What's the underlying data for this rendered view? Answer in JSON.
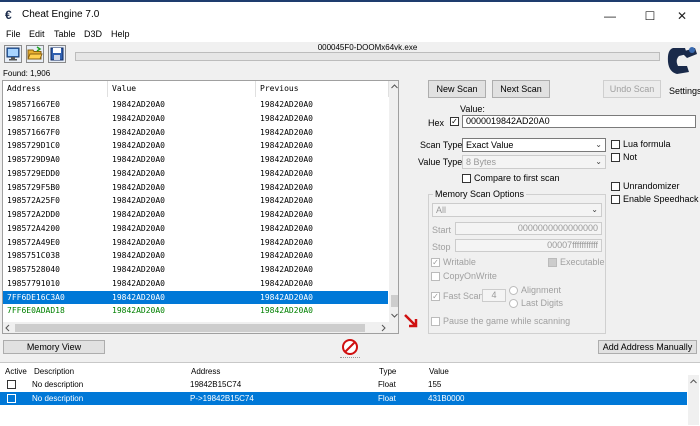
{
  "window": {
    "title": "Cheat Engine 7.0",
    "app_icon_glyph": "€",
    "minimize_glyph": "—",
    "maximize_glyph": "☐",
    "close_glyph": "✕"
  },
  "menu": [
    "File",
    "Edit",
    "Table",
    "D3D",
    "Help"
  ],
  "process_name": "000045F0-DOOMx64vk.exe",
  "found_text": "Found: 1,906",
  "results": {
    "headers": [
      "Address",
      "Value",
      "Previous"
    ],
    "rows": [
      {
        "address": "198571667E0",
        "value": "19842AD20A0",
        "previous": "19842AD20A0"
      },
      {
        "address": "198571667E8",
        "value": "19842AD20A0",
        "previous": "19842AD20A0"
      },
      {
        "address": "198571667F0",
        "value": "19842AD20A0",
        "previous": "19842AD20A0"
      },
      {
        "address": "1985729D1C0",
        "value": "19842AD20A0",
        "previous": "19842AD20A0"
      },
      {
        "address": "1985729D9A0",
        "value": "19842AD20A0",
        "previous": "19842AD20A0"
      },
      {
        "address": "1985729EDD0",
        "value": "19842AD20A0",
        "previous": "19842AD20A0"
      },
      {
        "address": "1985729F5B0",
        "value": "19842AD20A0",
        "previous": "19842AD20A0"
      },
      {
        "address": "198572A25F0",
        "value": "19842AD20A0",
        "previous": "19842AD20A0"
      },
      {
        "address": "198572A2DD0",
        "value": "19842AD20A0",
        "previous": "19842AD20A0"
      },
      {
        "address": "198572A4200",
        "value": "19842AD20A0",
        "previous": "19842AD20A0"
      },
      {
        "address": "198572A49E0",
        "value": "19842AD20A0",
        "previous": "19842AD20A0"
      },
      {
        "address": "1985751C038",
        "value": "19842AD20A0",
        "previous": "19842AD20A0"
      },
      {
        "address": "19857528040",
        "value": "19842AD20A0",
        "previous": "19842AD20A0"
      },
      {
        "address": "19857791010",
        "value": "19842AD20A0",
        "previous": "19842AD20A0"
      },
      {
        "address": "7FF6DE16C3A0",
        "value": "19842AD20A0",
        "previous": "19842AD20A0",
        "selected": true
      },
      {
        "address": "7FF6E0ADAD18",
        "value": "19842AD20A0",
        "previous": "19842AD20A0",
        "static": true
      }
    ]
  },
  "scan": {
    "new_scan": "New Scan",
    "next_scan": "Next Scan",
    "undo_scan": "Undo Scan",
    "settings": "Settings",
    "value_label": "Value:",
    "hex_label": "Hex",
    "hex_checked": true,
    "value": "0000019842AD20A0",
    "scan_type_label": "Scan Type",
    "scan_type": "Exact Value",
    "value_type_label": "Value Type",
    "value_type": "8 Bytes",
    "compare_first": "Compare to first scan",
    "lua_formula": "Lua formula",
    "not_label": "Not",
    "unrandomizer": "Unrandomizer",
    "enable_speedhack": "Enable Speedhack"
  },
  "memory_options": {
    "title": "Memory Scan Options",
    "region": "All",
    "start_label": "Start",
    "start": "0000000000000000",
    "stop_label": "Stop",
    "stop": "00007fffffffffff",
    "writable": "Writable",
    "executable": "Executable",
    "copy_on_write": "CopyOnWrite",
    "fast_scan": "Fast Scan",
    "fast_scan_value": "4",
    "alignment": "Alignment",
    "last_digits": "Last Digits",
    "pause_game": "Pause the game while scanning"
  },
  "bottom": {
    "memory_view": "Memory View",
    "add_address": "Add Address Manually"
  },
  "address_table": {
    "headers": [
      "Active",
      "Description",
      "Address",
      "Type",
      "Value"
    ],
    "rows": [
      {
        "description": "No description",
        "address": "19842B15C74",
        "type": "Float",
        "value": "155"
      },
      {
        "description": "No description",
        "address": "P->19842B15C74",
        "type": "Float",
        "value": "431B0000",
        "selected": true
      }
    ]
  },
  "colors": {
    "selection": "#0078d7",
    "static_address": "#008000",
    "stop_red": "#d01010"
  }
}
